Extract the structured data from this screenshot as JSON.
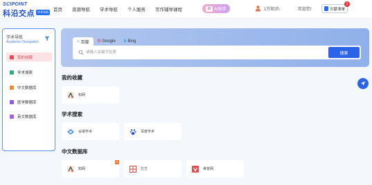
{
  "header": {
    "logo_en": "SCIPOINT",
    "logo_cn": "科沿交点",
    "logo_tag": "学术导航",
    "nav": [
      "首页",
      "资源导航",
      "学术导航",
      "个人服务",
      "写作辅导课程"
    ],
    "ai_label": "AI助手",
    "ai_badge": "AI",
    "user_name": "1万知识-",
    "welcome": "欢迎您!",
    "doc_label": "文献清单",
    "doc_count": "1"
  },
  "sidebar": {
    "title": "学术导航",
    "subtitle": "Academic Navigation",
    "items": [
      {
        "label": "我的收藏",
        "color": "#e84a57"
      },
      {
        "label": "学术搜索",
        "color": "#27b27a"
      },
      {
        "label": "中文数据库",
        "color": "#f28a2b"
      },
      {
        "label": "医学数据库",
        "color": "#8a5ce8"
      },
      {
        "label": "英文数据库",
        "color": "#a25ee0"
      }
    ]
  },
  "search": {
    "tabs": [
      "百度",
      "Google",
      "Bing"
    ],
    "placeholder": "请输入关键字检索",
    "button": "搜索"
  },
  "sections": {
    "favorites": {
      "title": "我的收藏",
      "cards": [
        "知网"
      ]
    },
    "academic": {
      "title": "学术搜索",
      "cards": [
        "谷歌学术",
        "百度学术"
      ]
    },
    "chinese_db": {
      "title": "中文数据库",
      "cards": [
        "知网",
        "万方",
        "维普网"
      ],
      "hot_tag": "H"
    }
  },
  "colors": {
    "accent": "#2b64e8",
    "active_bg": "#fbe3e5"
  }
}
